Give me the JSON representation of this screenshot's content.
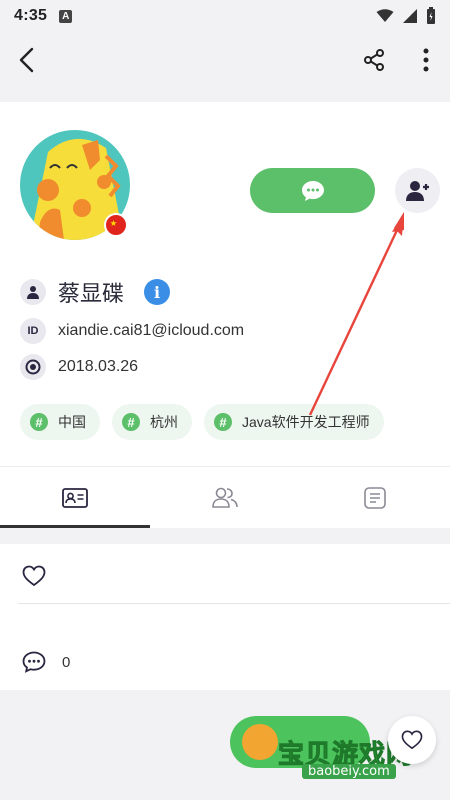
{
  "status_bar": {
    "time": "4:35",
    "notification_letter": "A"
  },
  "app_bar": {
    "back_icon": "back-arrow-icon",
    "share_icon": "share-icon",
    "more_icon": "more-vertical-icon"
  },
  "profile": {
    "name": "蔡显碟",
    "id": "xiandie.cai81@icloud.com",
    "date": "2018.03.26",
    "verify_glyph": "i",
    "avatar": "giraffe-avatar",
    "flag": "china-flag",
    "id_label": "ID"
  },
  "actions": {
    "message_icon": "chat-bubble-icon",
    "follow_icon": "add-user-icon"
  },
  "tags": [
    {
      "label": "中国"
    },
    {
      "label": "杭州"
    },
    {
      "label": "Java软件开发工程师"
    }
  ],
  "tabs": [
    {
      "icon": "id-card-icon",
      "active": true
    },
    {
      "icon": "friends-icon",
      "active": false
    },
    {
      "icon": "document-icon",
      "active": false
    }
  ],
  "list": {
    "like_icon": "heart-icon",
    "comment_icon": "comment-icon",
    "comment_count": "0"
  },
  "watermark": {
    "text": "宝贝游戏网",
    "url": "baobeiy.com"
  },
  "colors": {
    "accent_green": "#5cbf6a",
    "annotation_red": "#e8453c",
    "verify_blue": "#3a8ee6"
  }
}
